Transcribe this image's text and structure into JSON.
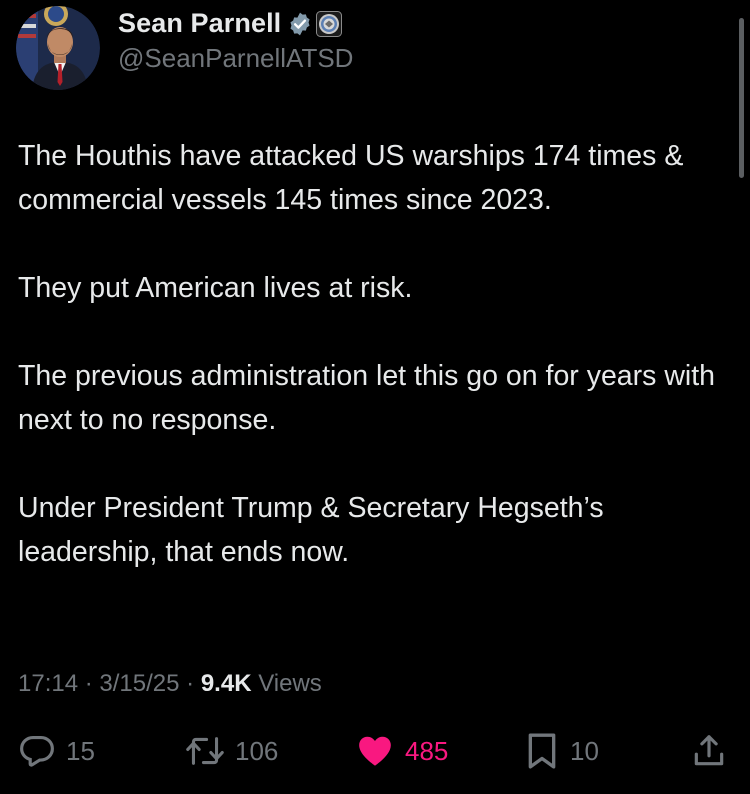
{
  "author": {
    "display_name": "Sean Parnell",
    "handle": "@SeanParnellATSD",
    "verified_icon": "verified-badge-icon",
    "affiliation_icon": "department-of-defense-seal-icon"
  },
  "post": {
    "paragraphs": [
      "The Houthis have attacked US warships 174 times & commercial vessels 145 times since 2023.",
      "They put American lives at risk.",
      "The previous administration let this go on for years with next to no response.",
      "Under President Trump & Secretary Hegseth’s leadership, that ends now."
    ]
  },
  "meta": {
    "time": "17:14",
    "date": "3/15/25",
    "views_count": "9.4K",
    "views_label": "Views"
  },
  "actions": {
    "replies": "15",
    "reposts": "106",
    "likes": "485",
    "bookmarks": "10"
  },
  "colors": {
    "background": "#000000",
    "text": "#e7e9ea",
    "secondary": "#71767b",
    "like": "#f91880",
    "verified": "#829aab"
  }
}
